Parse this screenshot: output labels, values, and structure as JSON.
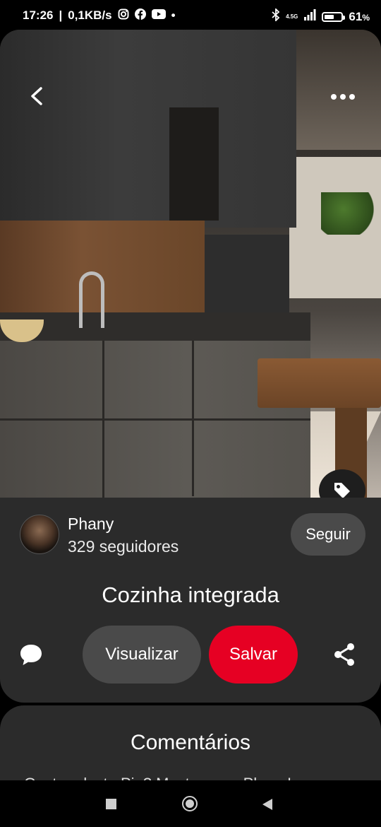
{
  "status_bar": {
    "time": "17:26",
    "network_speed": "0,1KB/s",
    "network_type": "4.5G",
    "battery": "61",
    "battery_unit": "%",
    "battery_level": 0.61,
    "icons": [
      "instagram-icon",
      "facebook-icon",
      "youtube-icon",
      "bluetooth-icon",
      "signal-icon",
      "battery-icon"
    ]
  },
  "pin": {
    "author_name": "Phany",
    "followers": "329 seguidores",
    "follow_label": "Seguir",
    "title": "Cozinha integrada",
    "visit_label": "Visualizar",
    "save_label": "Salvar"
  },
  "comments": {
    "title": "Comentários",
    "preview": "Gostou dosto Pin? Mostre para Phany!"
  },
  "colors": {
    "save": "#e60023",
    "panel": "#2b2b2b",
    "secondary_button": "#4a4a4a"
  }
}
